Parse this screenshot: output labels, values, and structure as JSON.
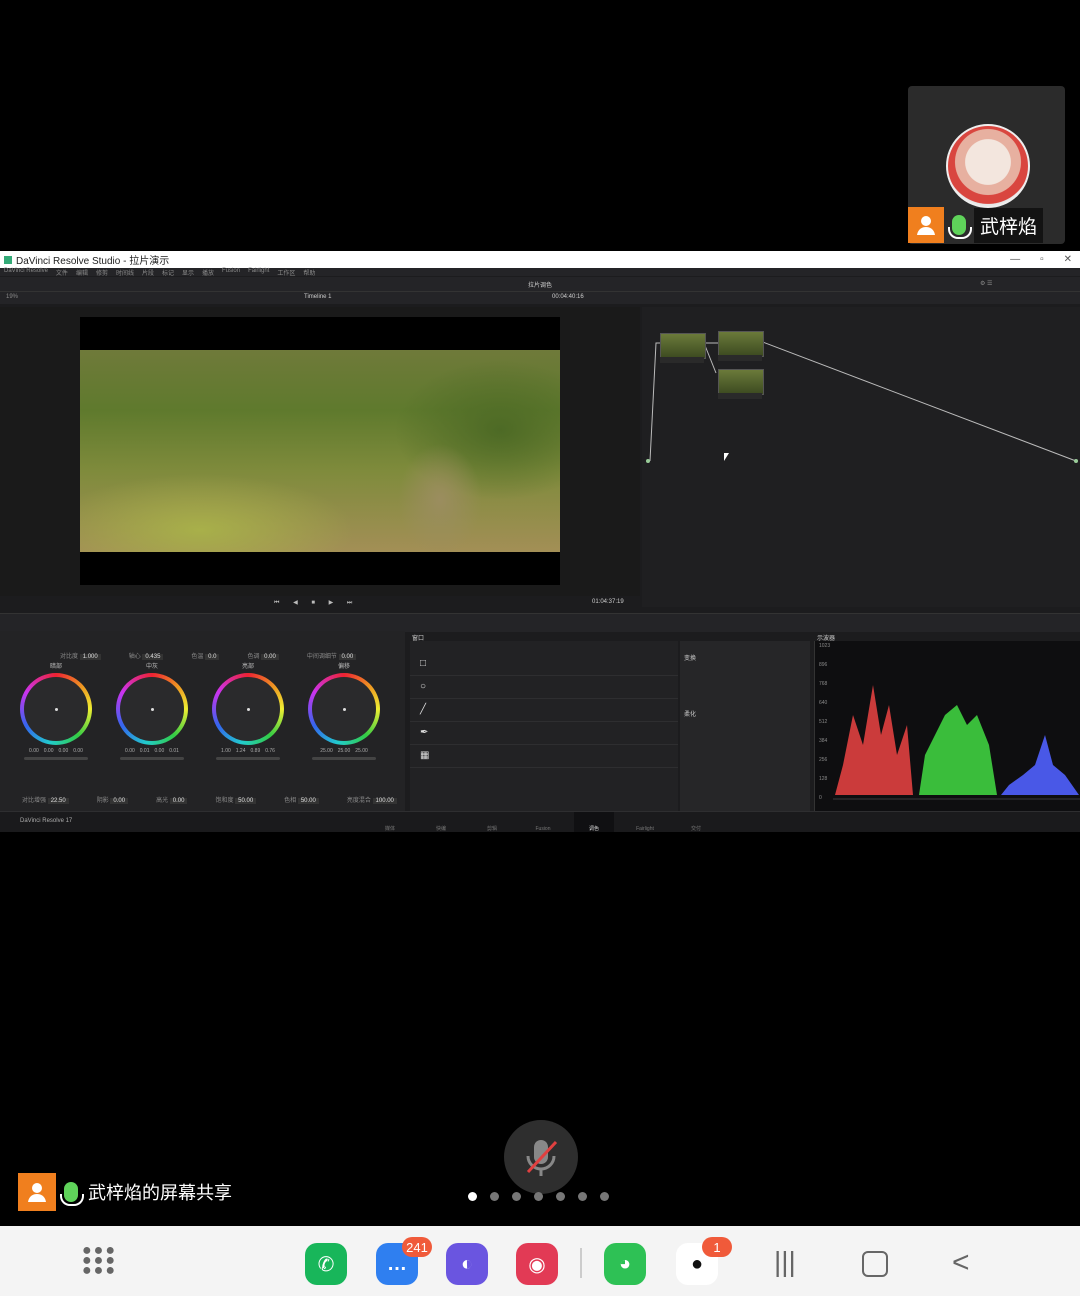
{
  "meeting": {
    "participant_name": "武梓焰",
    "share_label": "武梓焰的屏幕共享",
    "page_count": 7,
    "active_page": 1
  },
  "resolve": {
    "window_title": "DaVinci Resolve Studio - 拉片演示",
    "menu": [
      "DaVinci Resolve",
      "文件",
      "编辑",
      "修剪",
      "时间线",
      "片段",
      "标记",
      "显示",
      "播放",
      "Fusion",
      "Fairlight",
      "工作区",
      "帮助"
    ],
    "project_title": "拉片调色",
    "timeline_name": "Timeline 1",
    "zoom": "19%",
    "source_timecode": "00:04:40:16",
    "record_timecode": "01:04:37:19",
    "color_panel": {
      "top_params": [
        {
          "label": "对比度",
          "value": "1.000"
        },
        {
          "label": "轴心",
          "value": "0.435"
        },
        {
          "label": "色温",
          "value": "0.0"
        },
        {
          "label": "色调",
          "value": "0.00"
        },
        {
          "label": "中间调细节",
          "value": "0.00"
        }
      ],
      "wheels": [
        {
          "label": "暗部",
          "values": [
            "0.00",
            "0.00",
            "0.00",
            "0.00"
          ]
        },
        {
          "label": "中灰",
          "values": [
            "0.00",
            "0.01",
            "0.00",
            "0.01"
          ]
        },
        {
          "label": "亮部",
          "values": [
            "1.00",
            "1.24",
            "0.89",
            "0.76"
          ]
        },
        {
          "label": "偏移",
          "values": [
            "25.00",
            "25.00",
            "25.00"
          ]
        }
      ],
      "bottom_params": [
        {
          "label": "对比增强",
          "value": "22.50"
        },
        {
          "label": "阴影",
          "value": "0.00"
        },
        {
          "label": "高光",
          "value": "0.00"
        },
        {
          "label": "饱和度",
          "value": "50.00"
        },
        {
          "label": "色相",
          "value": "50.00"
        },
        {
          "label": "亮度混合",
          "value": "100.00"
        }
      ]
    },
    "window_panel_title": "窗口",
    "shapes": [
      "square-icon",
      "circle-icon",
      "line-icon",
      "pen-icon",
      "gradient-icon"
    ],
    "side_sections": [
      "变换",
      "柔化"
    ],
    "scopes_title": "示波器",
    "scope_labels": [
      "1023",
      "896",
      "768",
      "640",
      "512",
      "384",
      "256",
      "128",
      "0"
    ],
    "pages": [
      "媒体",
      "快编",
      "剪辑",
      "Fusion",
      "调色",
      "Fairlight",
      "交付"
    ],
    "active_page": "调色",
    "app_version": "DaVinci Resolve 17"
  },
  "dock": {
    "apps": [
      {
        "name": "phone",
        "glyph": "✆",
        "color": "#18b65a"
      },
      {
        "name": "messages",
        "glyph": "…",
        "color": "#2f7ff0",
        "badge": "241"
      },
      {
        "name": "internet",
        "glyph": "◐",
        "color": "#6a55e0"
      },
      {
        "name": "camera",
        "glyph": "◉",
        "color": "#e23a55"
      },
      {
        "name": "wechat",
        "glyph": "◕",
        "color": "#2ec155"
      },
      {
        "name": "qq",
        "glyph": "●",
        "color": "#ffffff",
        "badge": "1"
      }
    ]
  }
}
